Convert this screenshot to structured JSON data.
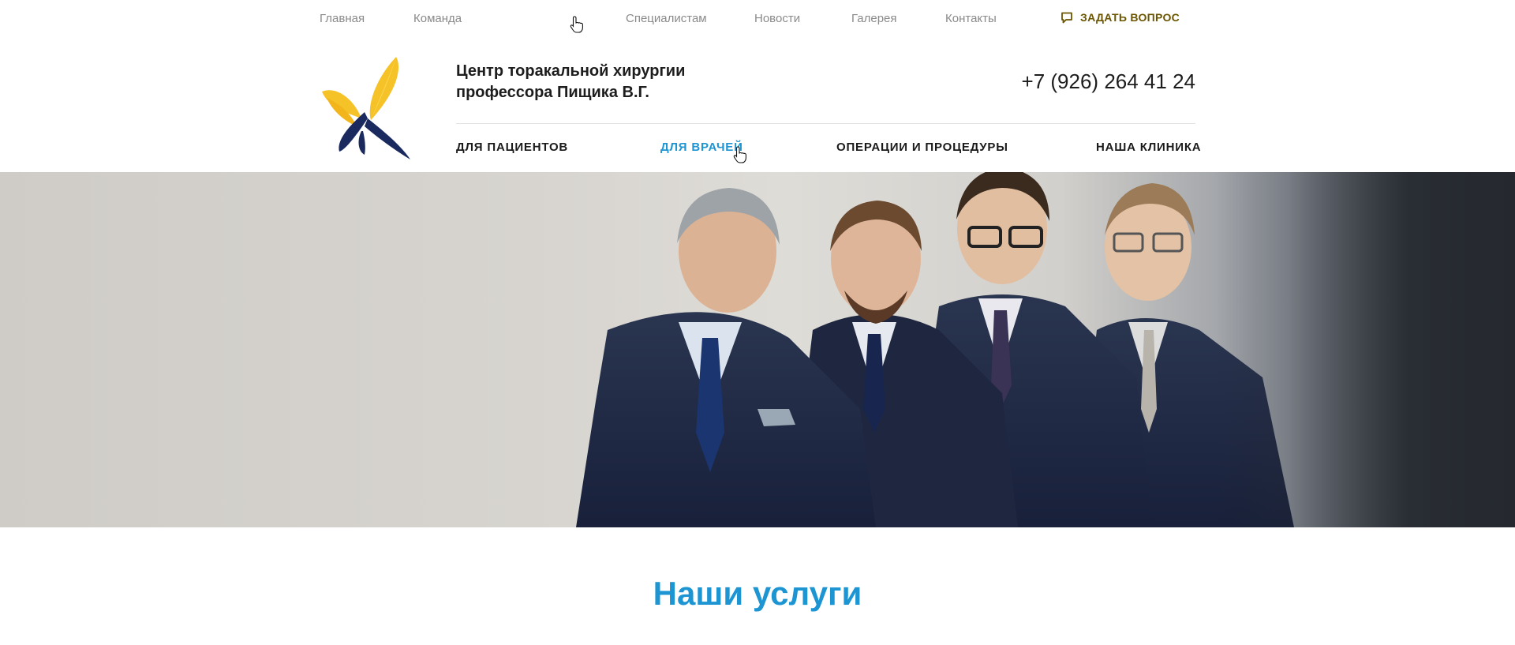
{
  "top_nav": {
    "items": [
      {
        "label": "Главная"
      },
      {
        "label": "Команда"
      },
      {
        "label": "Специалистам"
      },
      {
        "label": "Новости"
      },
      {
        "label": "Галерея"
      },
      {
        "label": "Контакты"
      }
    ],
    "ask_question": {
      "label": "ЗАДАТЬ ВОПРОС",
      "icon": "chat-bubble-icon"
    }
  },
  "header": {
    "brand_line1": "Центр торакальной хирургии",
    "brand_line2": "профессора Пищика В.Г.",
    "phone": "+7 (926) 264 41 24",
    "logo": "butterfly-logo"
  },
  "main_nav": {
    "items": [
      {
        "label": "ДЛЯ ПАЦИЕНТОВ",
        "active": false
      },
      {
        "label": "ДЛЯ ВРАЧЕЙ",
        "active": true
      },
      {
        "label": "ОПЕРАЦИИ И ПРОЦЕДУРЫ",
        "active": false
      },
      {
        "label": "НАША КЛИНИКА",
        "active": false
      }
    ]
  },
  "hero": {
    "image": "team-of-four-surgeons-photo"
  },
  "services": {
    "title": "Наши услуги"
  },
  "colors": {
    "accent_blue": "#1d95d3",
    "ask_gold": "#6b5500",
    "logo_yellow": "#f5c228",
    "logo_navy": "#1b2a5e",
    "nav_gray": "#8a8a8a"
  }
}
